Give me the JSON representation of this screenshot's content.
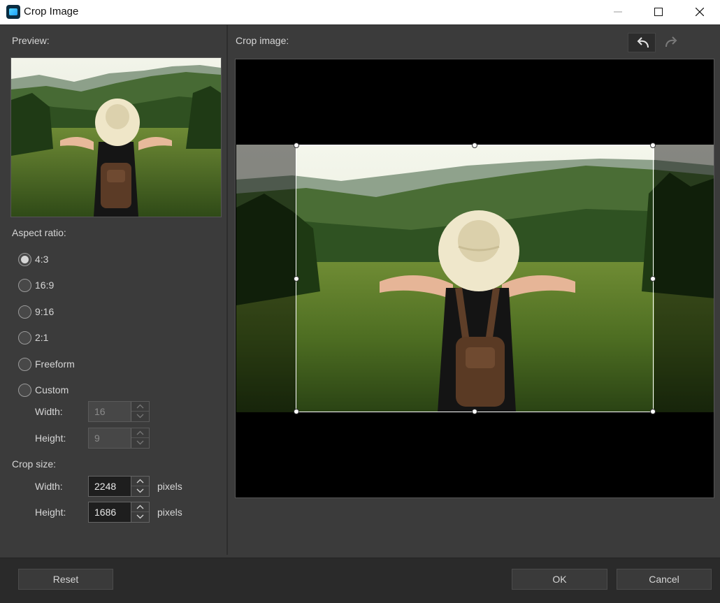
{
  "window": {
    "title": "Crop Image",
    "icon": "app-icon",
    "controls": [
      "minimize-icon",
      "maximize-icon",
      "close-icon"
    ]
  },
  "preview": {
    "label": "Preview:"
  },
  "aspect_ratio": {
    "label": "Aspect ratio:",
    "options": [
      {
        "label": "4:3",
        "checked": true
      },
      {
        "label": "16:9",
        "checked": false
      },
      {
        "label": "9:16",
        "checked": false
      },
      {
        "label": "2:1",
        "checked": false
      },
      {
        "label": "Freeform",
        "checked": false
      },
      {
        "label": "Custom",
        "checked": false
      }
    ],
    "custom": {
      "width_label": "Width:",
      "width_value": "16",
      "height_label": "Height:",
      "height_value": "9"
    }
  },
  "crop_size": {
    "label": "Crop size:",
    "width_label": "Width:",
    "width_value": "2248",
    "height_label": "Height:",
    "height_value": "1686",
    "unit": "pixels"
  },
  "crop_area": {
    "label": "Crop image:",
    "undo_icon": "undo-icon",
    "redo_icon": "redo-icon"
  },
  "buttons": {
    "reset": "Reset",
    "ok": "OK",
    "cancel": "Cancel"
  }
}
